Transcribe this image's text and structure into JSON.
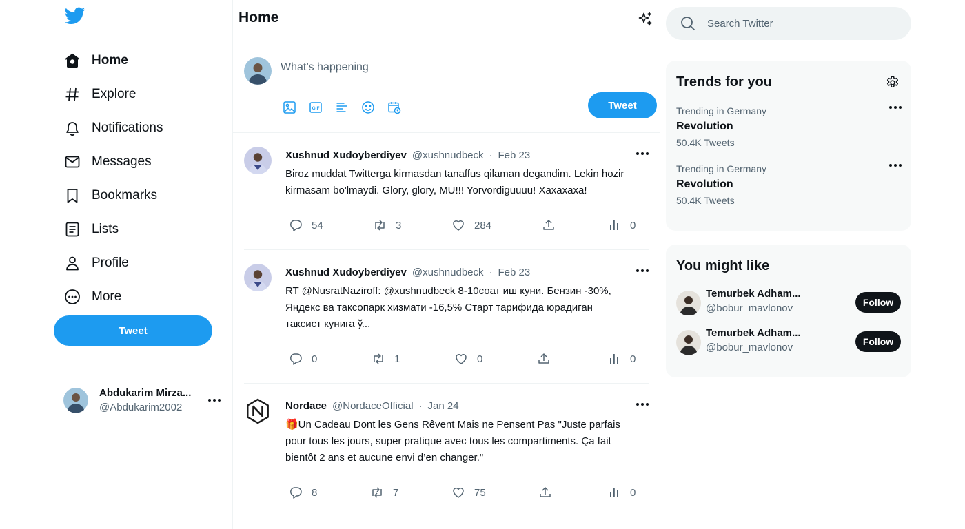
{
  "nav": {
    "items": [
      {
        "label": "Home",
        "icon": "home-icon"
      },
      {
        "label": "Explore",
        "icon": "hashtag-icon"
      },
      {
        "label": "Notifications",
        "icon": "bell-icon"
      },
      {
        "label": "Messages",
        "icon": "envelope-icon"
      },
      {
        "label": "Bookmarks",
        "icon": "bookmark-icon"
      },
      {
        "label": "Lists",
        "icon": "list-icon"
      },
      {
        "label": "Profile",
        "icon": "person-icon"
      },
      {
        "label": "More",
        "icon": "more-circle-icon"
      }
    ],
    "tweet_button": "Tweet"
  },
  "account": {
    "name": "Abdukarim Mirza...",
    "handle": "@Abdukarim2002"
  },
  "main": {
    "title": "Home",
    "compose": {
      "placeholder": "What’s happening",
      "tweet_button": "Tweet",
      "tools": [
        "image-icon",
        "gif-icon",
        "poll-icon",
        "emoji-icon",
        "schedule-icon"
      ]
    },
    "tweets": [
      {
        "name": "Xushnud Xudoyberdiyev",
        "handle": "@xushnudbeck",
        "dot": "·",
        "date": "Feb 23",
        "text": "Biroz muddat Twitterga kirmasdan tanaffus qilaman degandim. Lekin hozir kirmasam bo'lmaydi. Glory, glory, MU!!! Yorvordiguuuu! Xaxaxaxa!",
        "replies": "54",
        "retweets": "3",
        "likes": "284",
        "views": "0"
      },
      {
        "name": "Xushnud Xudoyberdiyev",
        "handle": "@xushnudbeck",
        "dot": "·",
        "date": "Feb 23",
        "text": "RT @NusratNaziroff: @xushnudbeck 8-10соат иш куни. Бензин -30%, Яндекс ва таксопарк хизмати -16,5% Старт тарифида юрадиган таксист кунига ў...",
        "replies": "0",
        "retweets": "1",
        "likes": "0",
        "views": "0"
      },
      {
        "name": "Nordace",
        "handle": "@NordaceOfficial",
        "dot": "·",
        "date": "Jan 24",
        "text": "🎁Un Cadeau Dont les Gens Rêvent Mais ne Pensent Pas \"Juste parfais pour tous les jours, super pratique avec tous les compartiments. Ça fait bientôt 2 ans et aucune envi d’en changer.\"",
        "replies": "8",
        "retweets": "7",
        "likes": "75",
        "views": "0"
      }
    ]
  },
  "right": {
    "search_placeholder": "Search Twitter",
    "trends": {
      "title": "Trends for you",
      "items": [
        {
          "context": "Trending in Germany",
          "topic": "Revolution",
          "count": "50.4K Tweets"
        },
        {
          "context": "Trending in Germany",
          "topic": "Revolution",
          "count": "50.4K Tweets"
        }
      ]
    },
    "suggestions": {
      "title": "You might like",
      "items": [
        {
          "name": "Temurbek Adham...",
          "handle": "@bobur_mavlonov",
          "button": "Follow"
        },
        {
          "name": "Temurbek Adham...",
          "handle": "@bobur_mavlonov",
          "button": "Follow"
        }
      ]
    }
  },
  "colors": {
    "accent": "#1d9bf0",
    "text": "#0f1419",
    "secondary": "#536471",
    "panel": "#f7f9f9"
  }
}
